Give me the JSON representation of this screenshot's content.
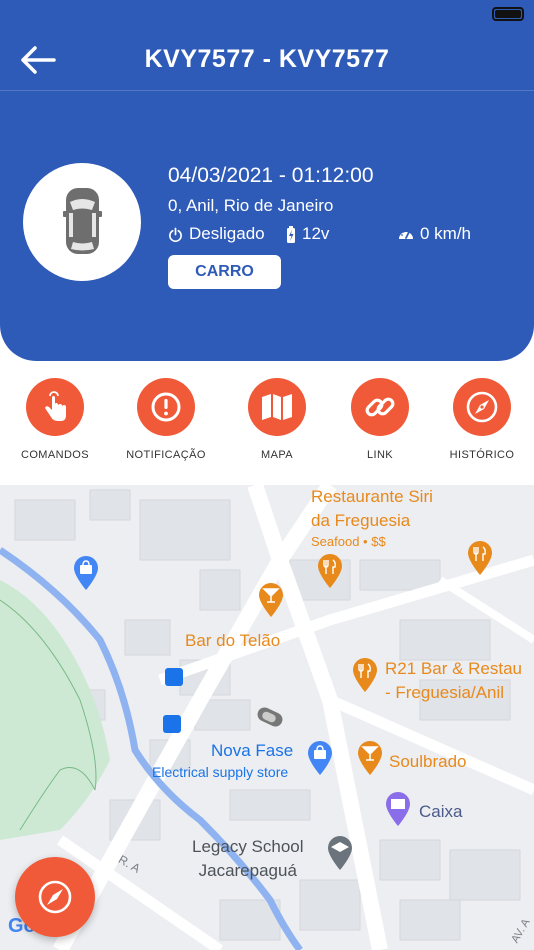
{
  "header": {
    "title": "KVY7577 - KVY7577",
    "datetime": "04/03/2021 - 01:12:00",
    "address": "0, Anil, Rio de Janeiro",
    "ignition": "Desligado",
    "voltage": "12v",
    "speed": "0 km/h",
    "vehicle_type": "CARRO"
  },
  "actions": [
    {
      "label": "COMANDOS",
      "icon": "hand-tap-icon"
    },
    {
      "label": "NOTIFICAÇÃO",
      "icon": "alert-icon"
    },
    {
      "label": "MAPA",
      "icon": "map-icon"
    },
    {
      "label": "LINK",
      "icon": "link-icon"
    },
    {
      "label": "HISTÓRICO",
      "icon": "compass-icon"
    }
  ],
  "map": {
    "places": [
      {
        "name": "Restaurante Siri",
        "name2": "da Freguesia",
        "sub": "Seafood • $$"
      },
      {
        "name": "Bar do Telão"
      },
      {
        "name": "R21 Bar & Restau",
        "name2": "- Freguesia/Anil"
      },
      {
        "name": "Nova Fase",
        "sub": "Electrical supply store"
      },
      {
        "name": "Soulbrado"
      },
      {
        "name": "Caixa"
      },
      {
        "name": "Legacy School",
        "name2": "Jacarepaguá"
      }
    ],
    "street_label": "R. A",
    "street_label_2": "AV. A",
    "attribution": "Google"
  },
  "colors": {
    "primary": "#2f5bb8",
    "accent": "#f05a38",
    "poi_orange": "#e8891c",
    "poi_blue": "#4285f4"
  }
}
